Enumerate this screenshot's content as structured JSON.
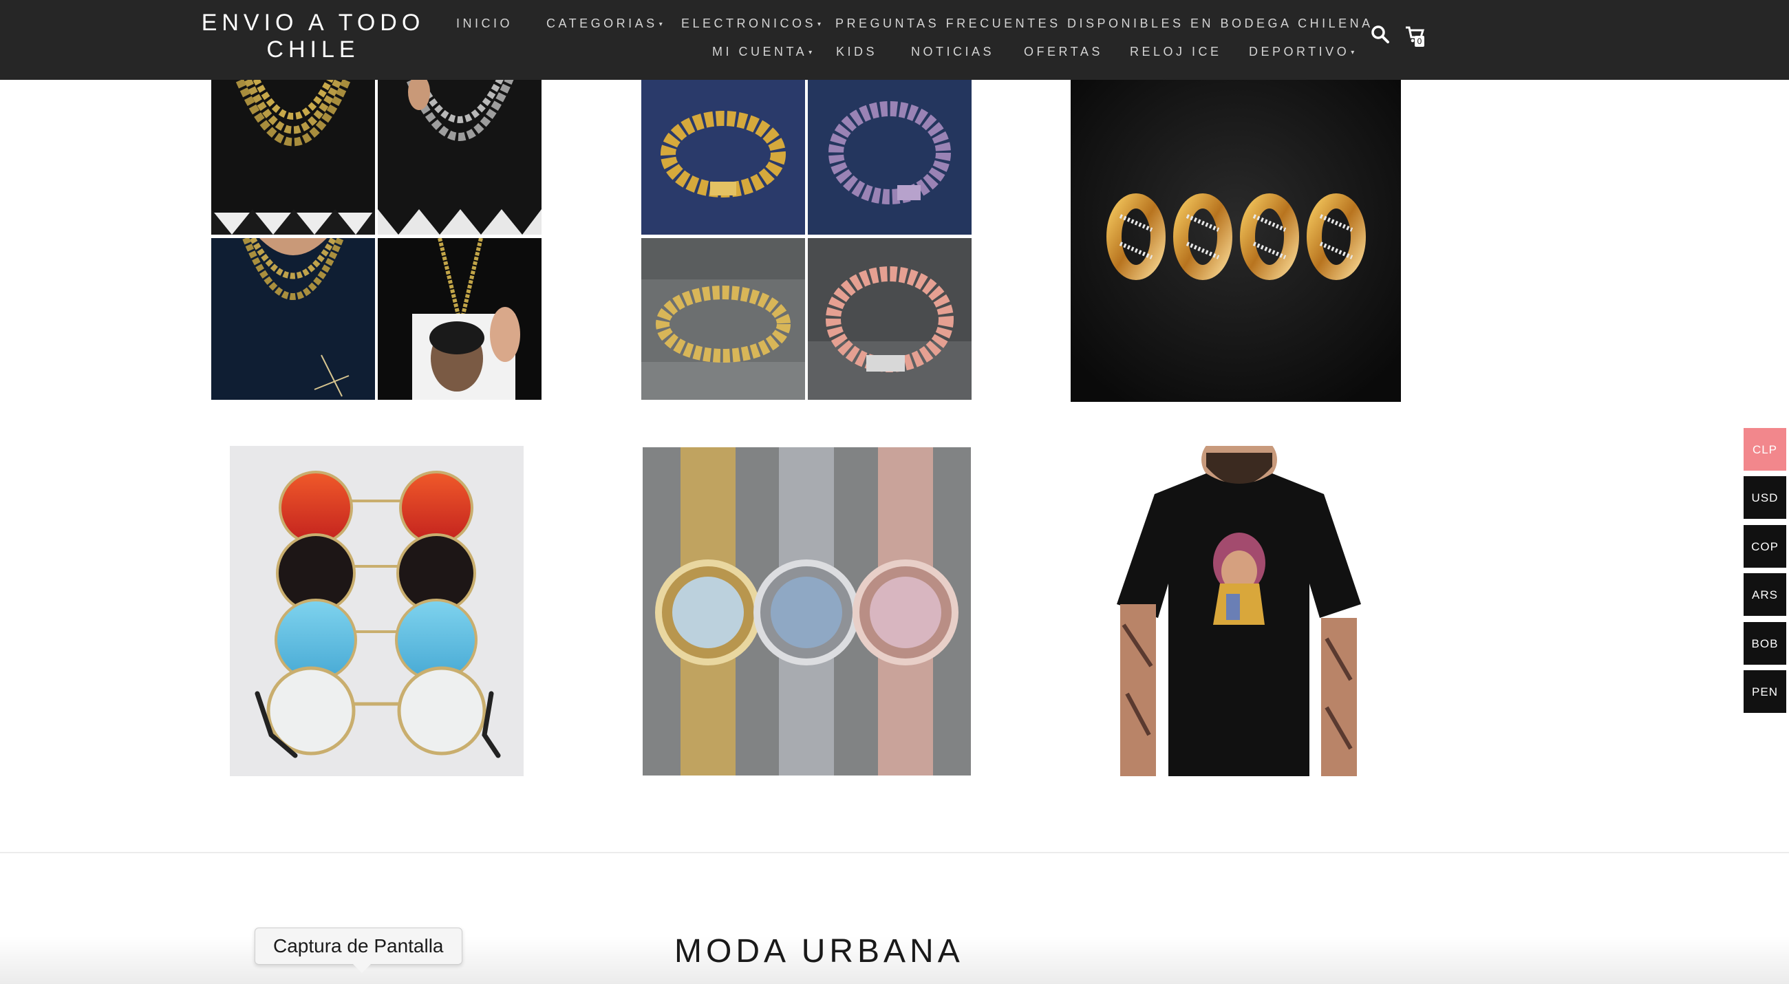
{
  "header": {
    "brand": "ENVIO A TODO CHILE",
    "nav_row1": [
      {
        "label": "INICIO",
        "dropdown": false
      },
      {
        "label": "CATEGORIAS",
        "dropdown": true
      },
      {
        "label": "ELECTRONICOS",
        "dropdown": true
      },
      {
        "label": "PREGUNTAS FRECUENTES",
        "dropdown": false
      },
      {
        "label": "DISPONIBLES EN BODEGA CHILENA",
        "dropdown": false
      }
    ],
    "nav_row2": [
      {
        "label": "MI CUENTA",
        "dropdown": true
      },
      {
        "label": "KIDS",
        "dropdown": false
      },
      {
        "label": "NOTICIAS",
        "dropdown": false
      },
      {
        "label": "OFERTAS",
        "dropdown": false
      },
      {
        "label": "RELOJ ICE",
        "dropdown": false
      },
      {
        "label": "DEPORTIVO",
        "dropdown": true
      }
    ],
    "search_icon": "search-icon",
    "cart_icon": "cart-icon",
    "cart_count": "0"
  },
  "products": [
    {
      "name": "necklaces-collage"
    },
    {
      "name": "bracelets-collage"
    },
    {
      "name": "rings"
    },
    {
      "name": "round-sunglasses"
    },
    {
      "name": "iced-watches"
    },
    {
      "name": "graphic-tshirt"
    }
  ],
  "currencies": [
    {
      "code": "CLP",
      "active": true
    },
    {
      "code": "USD",
      "active": false
    },
    {
      "code": "COP",
      "active": false
    },
    {
      "code": "ARS",
      "active": false
    },
    {
      "code": "BOB",
      "active": false
    },
    {
      "code": "PEN",
      "active": false
    }
  ],
  "section_title": "MODA URBANA",
  "tooltip": "Captura de Pantalla",
  "colors": {
    "header_bg": "#262626",
    "currency_active": "#f2878c",
    "currency_bg": "#111111"
  }
}
